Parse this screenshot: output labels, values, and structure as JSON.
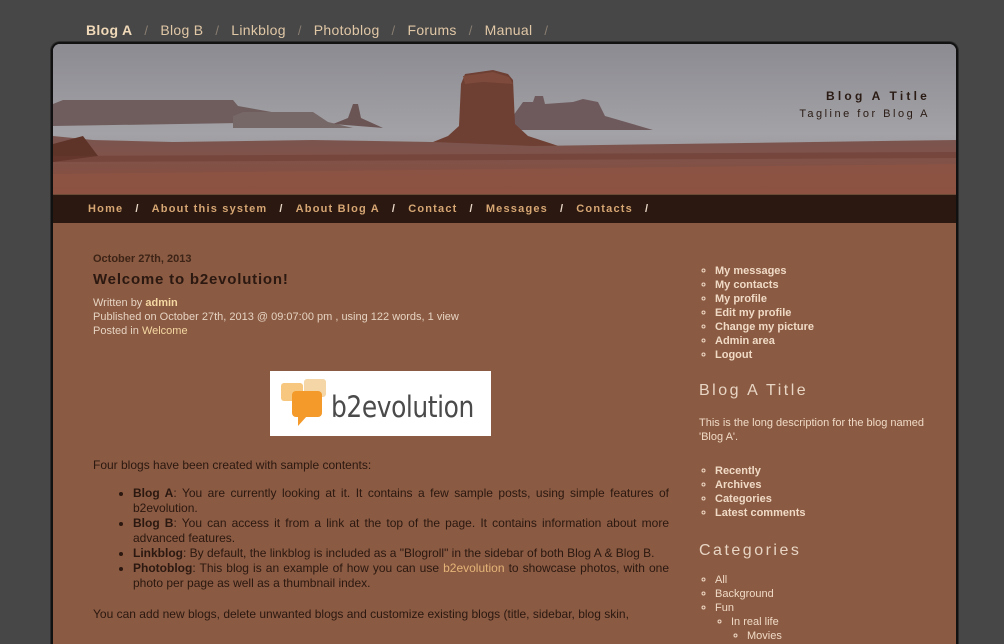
{
  "blog_tabs": [
    "Blog A",
    "Blog B",
    "Linkblog",
    "Photoblog",
    "Forums",
    "Manual"
  ],
  "header": {
    "title": "Blog A Title",
    "tagline": "Tagline for Blog A"
  },
  "menu": [
    "Home",
    "About this system",
    "About Blog A",
    "Contact",
    "Messages",
    "Contacts"
  ],
  "post": {
    "date": "October 27th, 2013",
    "title": "Welcome to b2evolution!",
    "written_by_label": "Written by",
    "author": "admin",
    "published": "Published on October 27th, 2013 @ 09:07:00 pm , using 122 words, 1 view",
    "posted_in_label": "Posted in",
    "category": "Welcome",
    "logo_text": "b2evolution",
    "intro": "Four blogs have been created with sample contents:",
    "items": [
      {
        "name": "Blog A",
        "text": ": You are currently looking at it. It contains a few sample posts, using simple features of b2evolution."
      },
      {
        "name": "Blog B",
        "text": ": You can access it from a link at the top of the page. It contains information about more advanced features."
      },
      {
        "name": "Linkblog",
        "text": ": By default, the linkblog is included as a \"Blogroll\" in the sidebar of both Blog A & Blog B."
      },
      {
        "name": "Photoblog",
        "text_before": ": This blog is an example of how you can use ",
        "link": "b2evolution",
        "text_after": " to showcase photos, with one photo per page as well as a thumbnail index."
      }
    ],
    "outro": "You can add new blogs, delete unwanted blogs and customize existing blogs (title, sidebar, blog skin,"
  },
  "sidebar": {
    "user_links": [
      "My messages",
      "My contacts",
      "My profile",
      "Edit my profile",
      "Change my picture",
      "Admin area",
      "Logout"
    ],
    "blog_title": "Blog A Title",
    "blog_desc": "This is the long description for the blog named 'Blog A'.",
    "nav_links": [
      "Recently",
      "Archives",
      "Categories",
      "Latest comments"
    ],
    "categories_title": "Categories",
    "categories": [
      "All",
      "Background",
      "Fun"
    ],
    "sub_categories": [
      "In real life"
    ],
    "sub_sub_categories": [
      "Movies"
    ]
  },
  "colors": {
    "page_bg": "#474747",
    "panel_bg": "#8a5a42",
    "menubar_bg": "#2b1810",
    "menu_text": "#d6a673",
    "link": "#f4d7a2"
  }
}
